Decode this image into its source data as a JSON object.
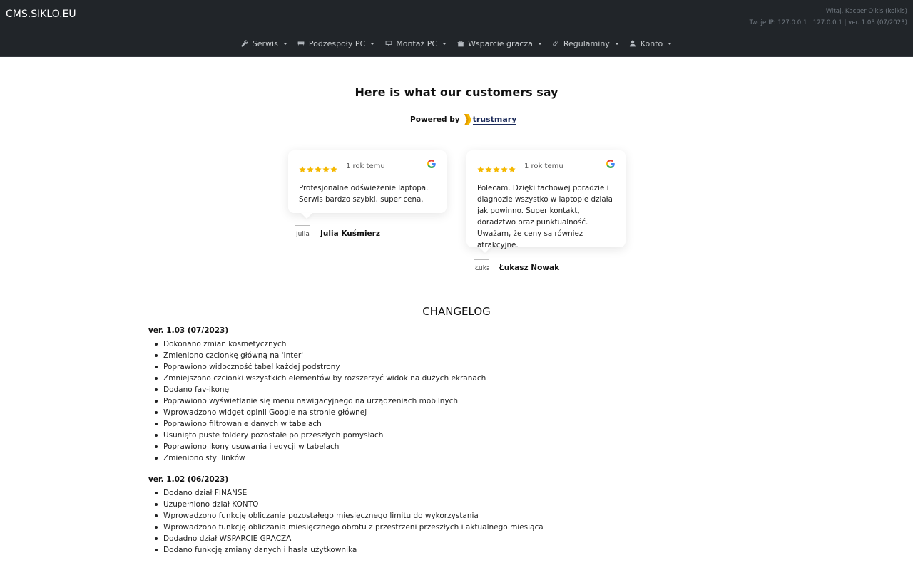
{
  "navbar": {
    "brand": "CMS.SIKLO.EU",
    "greeting": "Witaj, Kacper Olkis (kolkis)",
    "ip_info": "Twoje IP: 127.0.0.1 | 127.0.0.1 | ver. 1.03 (07/2023)",
    "menu": [
      {
        "label": "Serwis",
        "icon": "wrench-icon"
      },
      {
        "label": "Podzespoły PC",
        "icon": "memory-icon"
      },
      {
        "label": "Montaż PC",
        "icon": "desktop-icon"
      },
      {
        "label": "Wsparcie gracza",
        "icon": "gift-icon"
      },
      {
        "label": "Regulaminy",
        "icon": "paperclip-icon"
      },
      {
        "label": "Konto",
        "icon": "user-icon"
      }
    ]
  },
  "reviews": {
    "title": "Here is what our customers say",
    "powered_by": "Powered by",
    "provider": "trustmary",
    "items": [
      {
        "rating": 5,
        "date": "1 rok temu",
        "source_icon": "google-icon",
        "text": "Profesjonalne odświeżenie laptopa. Serwis bardzo szybki, super cena.",
        "author": "Julia Kuśmierz",
        "avatar_alt": "Julia"
      },
      {
        "rating": 5,
        "date": "1 rok temu",
        "source_icon": "google-icon",
        "text": "Polecam. Dzięki fachowej poradzie i diagnozie wszystko w laptopie działa jak powinno. Super kontakt, doradztwo oraz punktualność. Uważam, że ceny są również atrakcyjne.",
        "author": "Łukasz Nowak",
        "avatar_alt": "Łukasz"
      }
    ],
    "star_color": "#f5b800"
  },
  "changelog": {
    "title": "CHANGELOG",
    "versions": [
      {
        "version": "ver. 1.03 (07/2023)",
        "changes": [
          "Dokonano zmian kosmetycznych",
          "Zmieniono czcionkę główną na 'Inter'",
          "Poprawiono widoczność tabel każdej podstrony",
          "Zmniejszono czcionki wszystkich elementów by rozszerzyć widok na dużych ekranach",
          "Dodano fav-ikonę",
          "Poprawiono wyświetlanie się menu nawigacyjnego na urządzeniach mobilnych",
          "Wprowadzono widget opinii Google na stronie głównej",
          "Poprawiono filtrowanie danych w tabelach",
          "Usunięto puste foldery pozostałe po przeszłych pomysłach",
          "Poprawiono ikony usuwania i edycji w tabelach",
          "Zmieniono styl linków"
        ]
      },
      {
        "version": "ver. 1.02 (06/2023)",
        "changes": [
          "Dodano dział FINANSE",
          "Uzupełniono dział KONTO",
          "Wprowadzono funkcję obliczania pozostałego miesięcznego limitu do wykorzystania",
          "Wprowadzono funkcję obliczania miesięcznego obrotu z przestrzeni przeszłych i aktualnego miesiąca",
          "Dodadno dział WSPARCIE GRACZA",
          "Dodano funkcję zmiany danych i hasła użytkownika"
        ]
      }
    ]
  }
}
